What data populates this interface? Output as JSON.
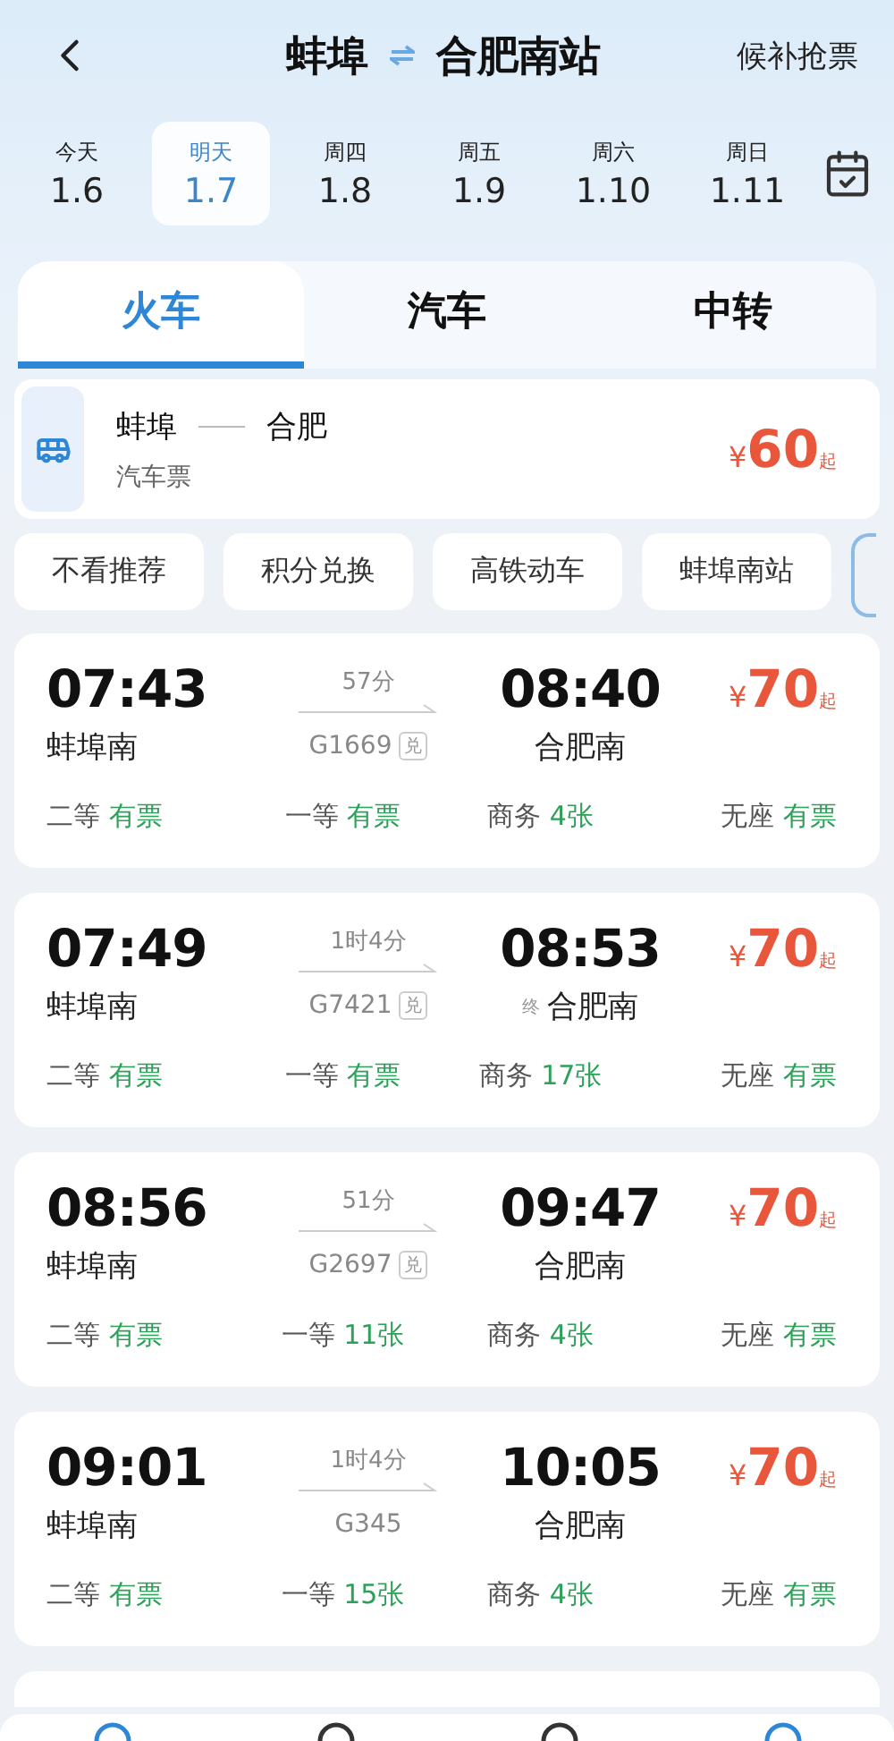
{
  "header": {
    "from": "蚌埠",
    "to": "合肥南站",
    "action": "候补抢票"
  },
  "dates": [
    {
      "day": "今天",
      "date": "1.6",
      "selected": false
    },
    {
      "day": "明天",
      "date": "1.7",
      "selected": true
    },
    {
      "day": "周四",
      "date": "1.8",
      "selected": false
    },
    {
      "day": "周五",
      "date": "1.9",
      "selected": false
    },
    {
      "day": "周六",
      "date": "1.10",
      "selected": false
    },
    {
      "day": "周日",
      "date": "1.11",
      "selected": false
    }
  ],
  "modes": [
    {
      "label": "火车",
      "selected": true
    },
    {
      "label": "汽车",
      "selected": false
    },
    {
      "label": "中转",
      "selected": false
    }
  ],
  "bus": {
    "from": "蚌埠",
    "to": "合肥",
    "type": "汽车票",
    "currency": "¥",
    "price": "60",
    "suffix": "起"
  },
  "filters": [
    "不看推荐",
    "积分兑换",
    "高铁动车",
    "蚌埠南站"
  ],
  "trains": [
    {
      "depart": "07:43",
      "from": "蚌埠南",
      "duration": "57分",
      "number": "G1669",
      "exchange": "兑",
      "arrive": "08:40",
      "to": "合肥南",
      "currency": "¥",
      "price": "70",
      "suffix": "起",
      "seats": [
        {
          "cls": "二等",
          "avail": "有票"
        },
        {
          "cls": "一等",
          "avail": "有票"
        },
        {
          "cls": "商务",
          "avail": "4张"
        },
        {
          "cls": "无座",
          "avail": "有票"
        }
      ]
    },
    {
      "depart": "07:49",
      "from": "蚌埠南",
      "duration": "1时4分",
      "number": "G7421",
      "exchange": "兑",
      "arrive": "08:53",
      "terminal": "终",
      "to": "合肥南",
      "currency": "¥",
      "price": "70",
      "suffix": "起",
      "seats": [
        {
          "cls": "二等",
          "avail": "有票"
        },
        {
          "cls": "一等",
          "avail": "有票"
        },
        {
          "cls": "商务",
          "avail": "17张"
        },
        {
          "cls": "无座",
          "avail": "有票"
        }
      ]
    },
    {
      "depart": "08:56",
      "from": "蚌埠南",
      "duration": "51分",
      "number": "G2697",
      "exchange": "兑",
      "arrive": "09:47",
      "to": "合肥南",
      "currency": "¥",
      "price": "70",
      "suffix": "起",
      "seats": [
        {
          "cls": "二等",
          "avail": "有票"
        },
        {
          "cls": "一等",
          "avail": "11张"
        },
        {
          "cls": "商务",
          "avail": "4张"
        },
        {
          "cls": "无座",
          "avail": "有票"
        }
      ]
    },
    {
      "depart": "09:01",
      "from": "蚌埠南",
      "duration": "1时4分",
      "number": "G345",
      "arrive": "10:05",
      "to": "合肥南",
      "currency": "¥",
      "price": "70",
      "suffix": "起",
      "seats": [
        {
          "cls": "二等",
          "avail": "有票"
        },
        {
          "cls": "一等",
          "avail": "15张"
        },
        {
          "cls": "商务",
          "avail": "4张"
        },
        {
          "cls": "无座",
          "avail": "有票"
        }
      ]
    }
  ]
}
